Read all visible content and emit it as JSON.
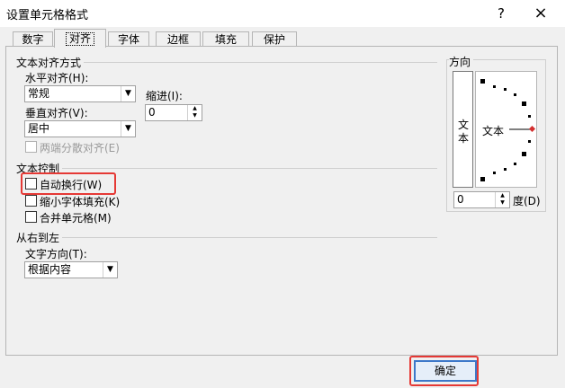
{
  "window": {
    "title": "设置单元格格式",
    "help": "?",
    "close": "×"
  },
  "tabs": [
    "数字",
    "对齐",
    "字体",
    "边框",
    "填充",
    "保护"
  ],
  "alignment": {
    "section_title": "文本对齐方式",
    "horizontal_label": "水平对齐(H):",
    "horizontal_value": "常规",
    "indent_label": "缩进(I):",
    "indent_value": "0",
    "vertical_label": "垂直对齐(V):",
    "vertical_value": "居中",
    "distributed_label": "两端分散对齐(E)"
  },
  "text_control": {
    "section_title": "文本控制",
    "wrap_text": "自动换行(W)",
    "shrink_to_fit": "缩小字体填充(K)",
    "merge_cells": "合并单元格(M)"
  },
  "rtl": {
    "section_title": "从右到左",
    "direction_label": "文字方向(T):",
    "direction_value": "根据内容"
  },
  "orientation": {
    "section_title": "方向",
    "vertical_text_1": "文",
    "vertical_text_2": "本",
    "dial_text": "文本",
    "degrees_value": "0",
    "degrees_label": "度(D)"
  },
  "buttons": {
    "ok": "确定"
  },
  "colors": {
    "highlight": "#e53935",
    "dial_marker": "#d32f2f"
  }
}
